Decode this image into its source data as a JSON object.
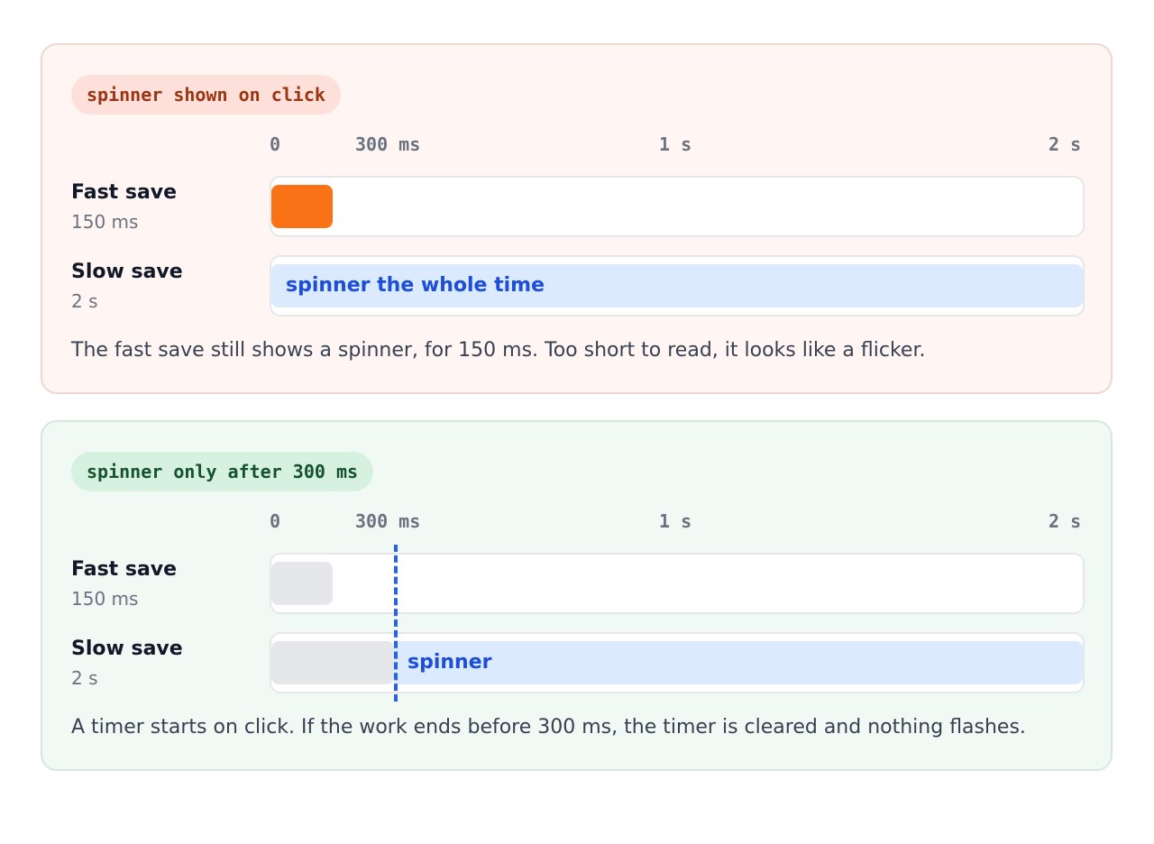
{
  "top_panel": {
    "tag": "spinner shown on click",
    "ticks": [
      "0",
      "300 ms",
      "1 s",
      "2 s"
    ],
    "rows": [
      {
        "label": "Fast save",
        "duration": "150 ms"
      },
      {
        "label": "Slow save",
        "duration": "2 s",
        "bar_text": "spinner the whole time"
      }
    ],
    "note": "The fast save still shows a spinner, for 150 ms. Too short to read, it looks like a flicker."
  },
  "bottom_panel": {
    "tag": "spinner only after 300 ms",
    "ticks": [
      "0",
      "300 ms",
      "1 s",
      "2 s"
    ],
    "rows": [
      {
        "label": "Fast save",
        "duration": "150 ms"
      },
      {
        "label": "Slow save",
        "duration": "2 s",
        "bar_text": "spinner"
      }
    ],
    "note": "A timer starts on click. If the work ends before 300 ms, the timer is cleared and nothing flashes."
  },
  "colors": {
    "spinner_flash": "#f97316",
    "spinner_bar": "#dbeafe",
    "idle_bar": "#e5e7eb",
    "threshold_line": "#2563eb"
  }
}
